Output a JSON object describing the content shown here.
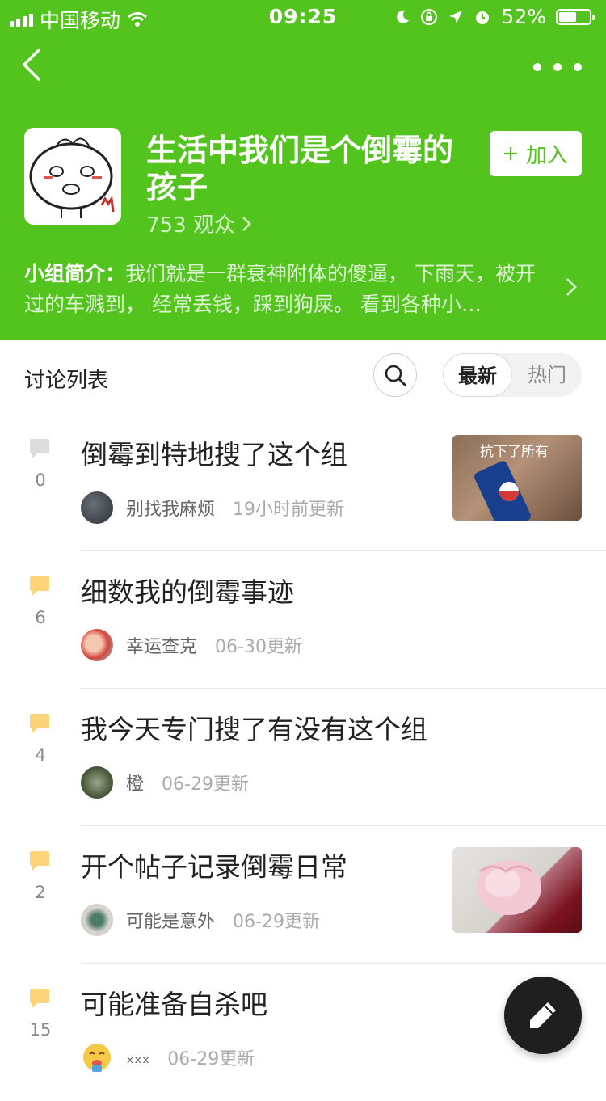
{
  "status_bar": {
    "carrier": "中国移动",
    "time": "09:25",
    "battery": "52%",
    "battery_level": 0.52
  },
  "group": {
    "title": "生活中我们是个倒霉的孩子",
    "audience": "753 观众",
    "join_label": "加入",
    "intro_label": "小组简介：",
    "intro_text": "我们就是一群衰神附体的傻逼， 下雨天，被开过的车溅到， 经常丢钱，踩到狗屎。 看到各种小…"
  },
  "list": {
    "title": "讨论列表",
    "sort_latest": "最新",
    "sort_hot": "热门",
    "posts": [
      {
        "title": "倒霉到特地搜了这个组",
        "replies": "0",
        "author": "别找我麻烦",
        "time": "19小时前更新",
        "thumb_text": "抗下了所有"
      },
      {
        "title": "细数我的倒霉事迹",
        "replies": "6",
        "author": "幸运查克",
        "time": "06-30更新"
      },
      {
        "title": "我今天专门搜了有没有这个组",
        "replies": "4",
        "author": "橙",
        "time": "06-29更新"
      },
      {
        "title": "开个帖子记录倒霉日常",
        "replies": "2",
        "author": "可能是意外",
        "time": "06-29更新"
      },
      {
        "title": "可能准备自杀吧",
        "replies": "15",
        "author": "ₓₓₓ",
        "time": "06-29更新"
      }
    ]
  },
  "colors": {
    "brand_green": "#53c41e",
    "fab": "#1f1f1f",
    "bubble_active": "#ffd37a",
    "bubble_inactive": "#dcdcdc"
  }
}
